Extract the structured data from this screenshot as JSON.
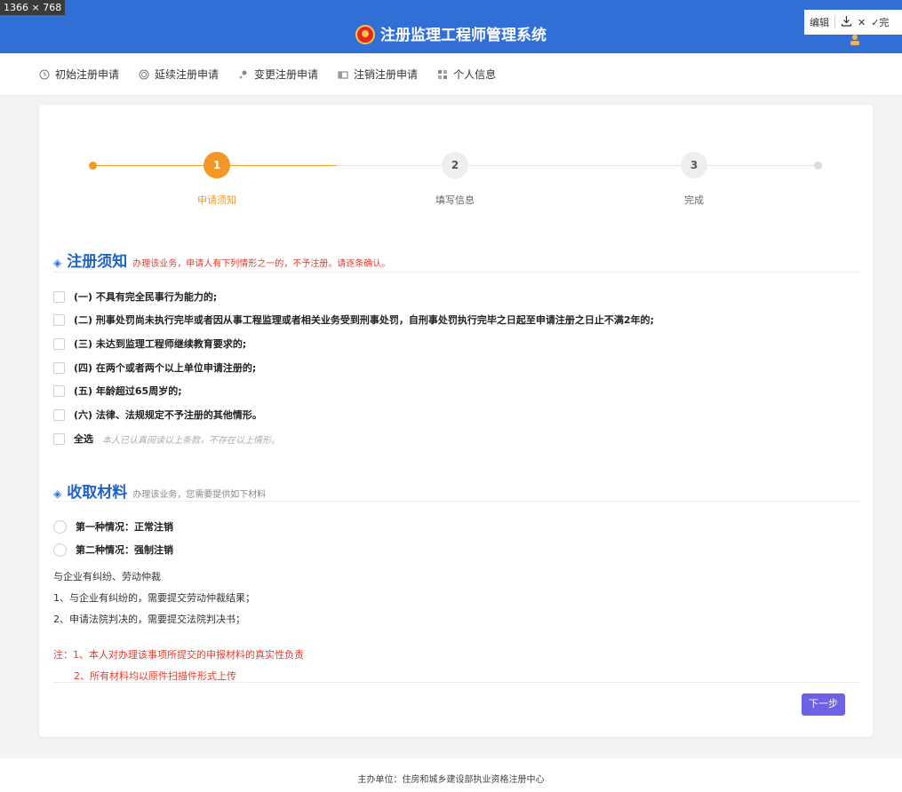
{
  "screen_size_label": "1366 × 768",
  "header": {
    "title": "注册监理工程师管理系统",
    "toolbar": {
      "edit": "编辑",
      "download_icon": "download-icon",
      "close": "✕",
      "done": "✓完"
    }
  },
  "nav": {
    "items": [
      {
        "label": "初始注册申请",
        "icon": "clock-icon"
      },
      {
        "label": "延续注册申请",
        "icon": "target-icon"
      },
      {
        "label": "变更注册申请",
        "icon": "pin-icon"
      },
      {
        "label": "注销注册申请",
        "icon": "card-icon"
      },
      {
        "label": "个人信息",
        "icon": "grid-icon"
      }
    ]
  },
  "steps": [
    {
      "number": "1",
      "label": "申请须知",
      "status": "active"
    },
    {
      "number": "2",
      "label": "填写信息",
      "status": "inactive"
    },
    {
      "number": "3",
      "label": "完成",
      "status": "inactive"
    }
  ],
  "notice": {
    "title": "注册须知",
    "subtitle": "办理该业务，申请人有下列情形之一的，不予注册。请逐条确认。",
    "items": [
      "(一) 不具有完全民事行为能力的;",
      "(二) 刑事处罚尚未执行完毕或者因从事工程监理或者相关业务受到刑事处罚，自刑事处罚执行完毕之日起至申请注册之日止不满2年的;",
      "(三) 未达到监理工程师继续教育要求的;",
      "(四) 在两个或者两个以上单位申请注册的;",
      "(五) 年龄超过65周岁的;",
      "(六) 法律、法规规定不予注册的其他情形。"
    ],
    "select_all_label": "全选",
    "select_all_hint": "本人已认真阅读以上条款，不存在以上情形。"
  },
  "materials": {
    "title": "收取材料",
    "subtitle": "办理该业务，您需要提供如下材料",
    "options": [
      "第一种情况：正常注销",
      "第二种情况：强制注销"
    ],
    "lines": [
      "与企业有纠纷、劳动仲裁",
      "1、与企业有纠纷的，需要提交劳动仲裁结果；",
      "2、申请法院判决的，需要提交法院判决书；"
    ],
    "notes": [
      "注：1、本人对办理该事项所提交的申报材料的真实性负责",
      "2、所有材料均以原件扫描件形式上传"
    ]
  },
  "next_button": "下一步",
  "footer": "主办单位：住房和城乡建设部执业资格注册中心",
  "colors": {
    "primary": "#2f6fd6",
    "accent": "#f39826",
    "button": "#6c62e8",
    "danger": "#e63a2e"
  }
}
